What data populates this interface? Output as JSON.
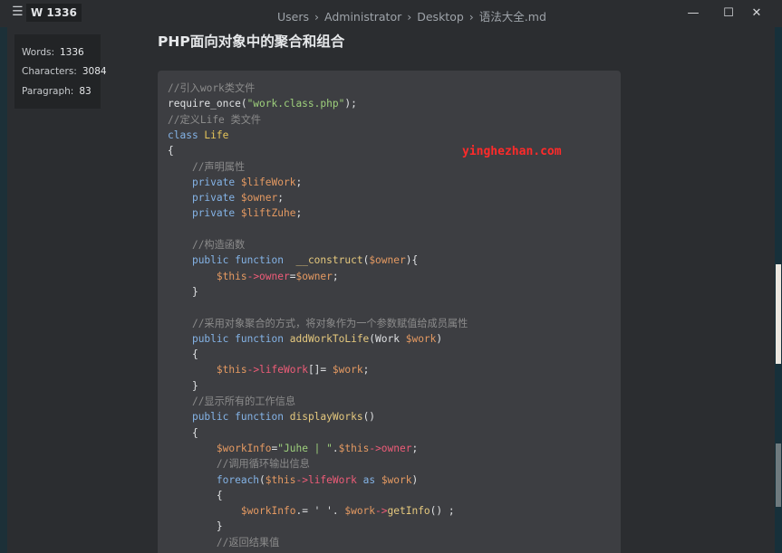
{
  "app": {
    "menu_icon": "☰",
    "word_badge": "W 1336"
  },
  "breadcrumb": [
    "Users",
    "Administrator",
    "Desktop",
    "语法大全.md"
  ],
  "breadcrumb_separator": "›",
  "window_controls": {
    "minimize": "—",
    "maximize": "☐",
    "close": "✕"
  },
  "stats": {
    "words_label": "Words:",
    "words_value": "1336",
    "characters_label": "Characters:",
    "characters_value": "3084",
    "paragraph_label": "Paragraph:",
    "paragraph_value": "83"
  },
  "document": {
    "heading": "PHP面向对象中的聚合和组合",
    "watermark": "yinghezhan.com"
  },
  "code_lines": [
    [
      [
        "cm",
        "//引入work类文件"
      ]
    ],
    [
      [
        "tx",
        "require_once("
      ],
      [
        "str",
        "\"work.class.php\""
      ],
      [
        "tx",
        ");"
      ]
    ],
    [
      [
        "cm",
        "//定义Life 类文件"
      ]
    ],
    [
      [
        "kw",
        "class "
      ],
      [
        "cls",
        "Life"
      ]
    ],
    [
      [
        "tx",
        "{"
      ]
    ],
    [
      [
        "tx",
        "    "
      ],
      [
        "cm",
        "//声明属性"
      ]
    ],
    [
      [
        "tx",
        "    "
      ],
      [
        "kw",
        "private "
      ],
      [
        "var",
        "$lifeWork"
      ],
      [
        "tx",
        ";"
      ]
    ],
    [
      [
        "tx",
        "    "
      ],
      [
        "kw",
        "private "
      ],
      [
        "var",
        "$owner"
      ],
      [
        "tx",
        ";"
      ]
    ],
    [
      [
        "tx",
        "    "
      ],
      [
        "kw",
        "private "
      ],
      [
        "var",
        "$liftZuhe"
      ],
      [
        "tx",
        ";"
      ]
    ],
    [
      [
        "tx",
        ""
      ]
    ],
    [
      [
        "tx",
        "    "
      ],
      [
        "cm",
        "//构造函数"
      ]
    ],
    [
      [
        "tx",
        "    "
      ],
      [
        "kw",
        "public function  "
      ],
      [
        "fn",
        "__construct"
      ],
      [
        "tx",
        "("
      ],
      [
        "var",
        "$owner"
      ],
      [
        "tx",
        "){"
      ]
    ],
    [
      [
        "tx",
        "        "
      ],
      [
        "var",
        "$this"
      ],
      [
        "prop",
        "->owner"
      ],
      [
        "tx",
        "="
      ],
      [
        "var",
        "$owner"
      ],
      [
        "tx",
        ";"
      ]
    ],
    [
      [
        "tx",
        "    }"
      ]
    ],
    [
      [
        "tx",
        ""
      ]
    ],
    [
      [
        "tx",
        "    "
      ],
      [
        "cm",
        "//采用对象聚合的方式，将对象作为一个参数赋值给成员属性"
      ]
    ],
    [
      [
        "tx",
        "    "
      ],
      [
        "kw",
        "public function "
      ],
      [
        "fn",
        "addWorkToLife"
      ],
      [
        "tx",
        "(Work "
      ],
      [
        "var",
        "$work"
      ],
      [
        "tx",
        ")"
      ]
    ],
    [
      [
        "tx",
        "    {"
      ]
    ],
    [
      [
        "tx",
        "        "
      ],
      [
        "var",
        "$this"
      ],
      [
        "prop",
        "->lifeWork"
      ],
      [
        "tx",
        "[]= "
      ],
      [
        "var",
        "$work"
      ],
      [
        "tx",
        ";"
      ]
    ],
    [
      [
        "tx",
        "    }"
      ]
    ],
    [
      [
        "tx",
        "    "
      ],
      [
        "cm",
        "//显示所有的工作信息"
      ]
    ],
    [
      [
        "tx",
        "    "
      ],
      [
        "kw",
        "public function "
      ],
      [
        "fn",
        "displayWorks"
      ],
      [
        "tx",
        "()"
      ]
    ],
    [
      [
        "tx",
        "    {"
      ]
    ],
    [
      [
        "tx",
        "        "
      ],
      [
        "var",
        "$workInfo"
      ],
      [
        "tx",
        "="
      ],
      [
        "str",
        "\"Juhe | \""
      ],
      [
        "tx",
        "."
      ],
      [
        "var",
        "$this"
      ],
      [
        "prop",
        "->owner"
      ],
      [
        "tx",
        ";"
      ]
    ],
    [
      [
        "tx",
        "        "
      ],
      [
        "cm",
        "//调用循环输出信息"
      ]
    ],
    [
      [
        "tx",
        "        "
      ],
      [
        "kw",
        "foreach"
      ],
      [
        "tx",
        "("
      ],
      [
        "var",
        "$this"
      ],
      [
        "prop",
        "->lifeWork"
      ],
      [
        "tx",
        " "
      ],
      [
        "kw",
        "as "
      ],
      [
        "var",
        "$work"
      ],
      [
        "tx",
        ")"
      ]
    ],
    [
      [
        "tx",
        "        {"
      ]
    ],
    [
      [
        "tx",
        "            "
      ],
      [
        "var",
        "$workInfo"
      ],
      [
        "tx",
        ".= ' '. "
      ],
      [
        "var",
        "$work"
      ],
      [
        "prop",
        "->"
      ],
      [
        "fn",
        "getInfo"
      ],
      [
        "tx",
        "() ;"
      ]
    ],
    [
      [
        "tx",
        "        }"
      ]
    ],
    [
      [
        "tx",
        "        "
      ],
      [
        "cm",
        "//返回结果值"
      ]
    ]
  ]
}
